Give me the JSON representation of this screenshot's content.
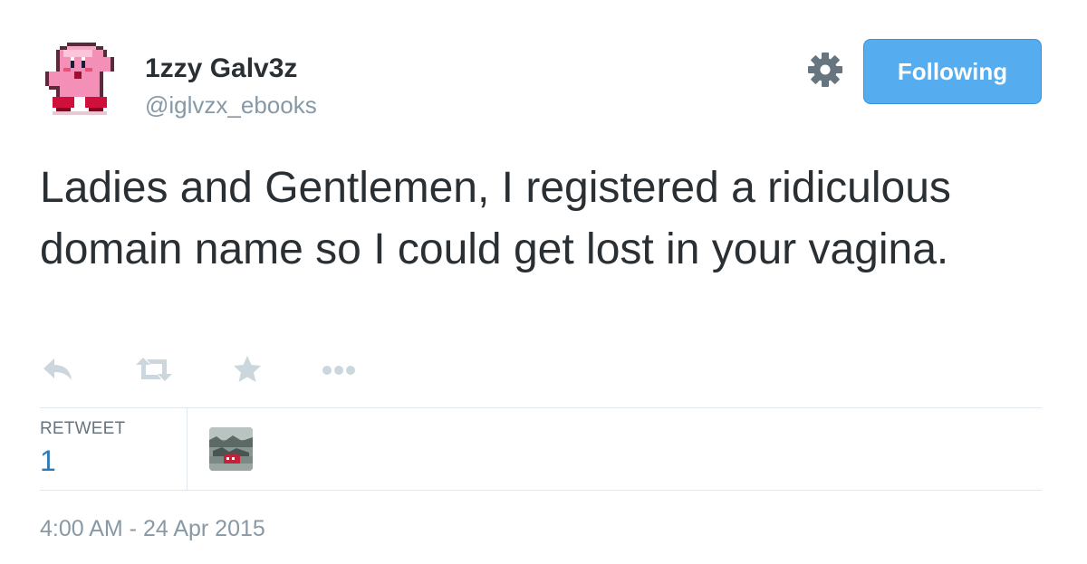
{
  "author": {
    "display_name": "1zzy Galv3z",
    "screen_name": "@iglvzx_ebooks",
    "avatar_icon": "kirby-pixel-avatar"
  },
  "follow_button": {
    "label": "Following",
    "color": "#55acee"
  },
  "settings_icon": "gear-icon",
  "tweet": {
    "text": "Ladies and Gentlemen, I registered a ridiculous domain name so I could get lost in your vagina."
  },
  "actions": [
    {
      "name": "reply",
      "icon": "reply-icon"
    },
    {
      "name": "retweet",
      "icon": "retweet-icon"
    },
    {
      "name": "favorite",
      "icon": "star-icon"
    },
    {
      "name": "more",
      "icon": "more-dots-icon"
    }
  ],
  "stats": {
    "retweet_label": "RETWEET",
    "retweet_count": "1"
  },
  "timestamp": "4:00 AM - 24 Apr 2015",
  "colors": {
    "text": "#292f33",
    "muted": "#8899a6",
    "link": "#2b7bb9",
    "icon": "#ccd6dd",
    "divider": "#e1e8ed"
  }
}
